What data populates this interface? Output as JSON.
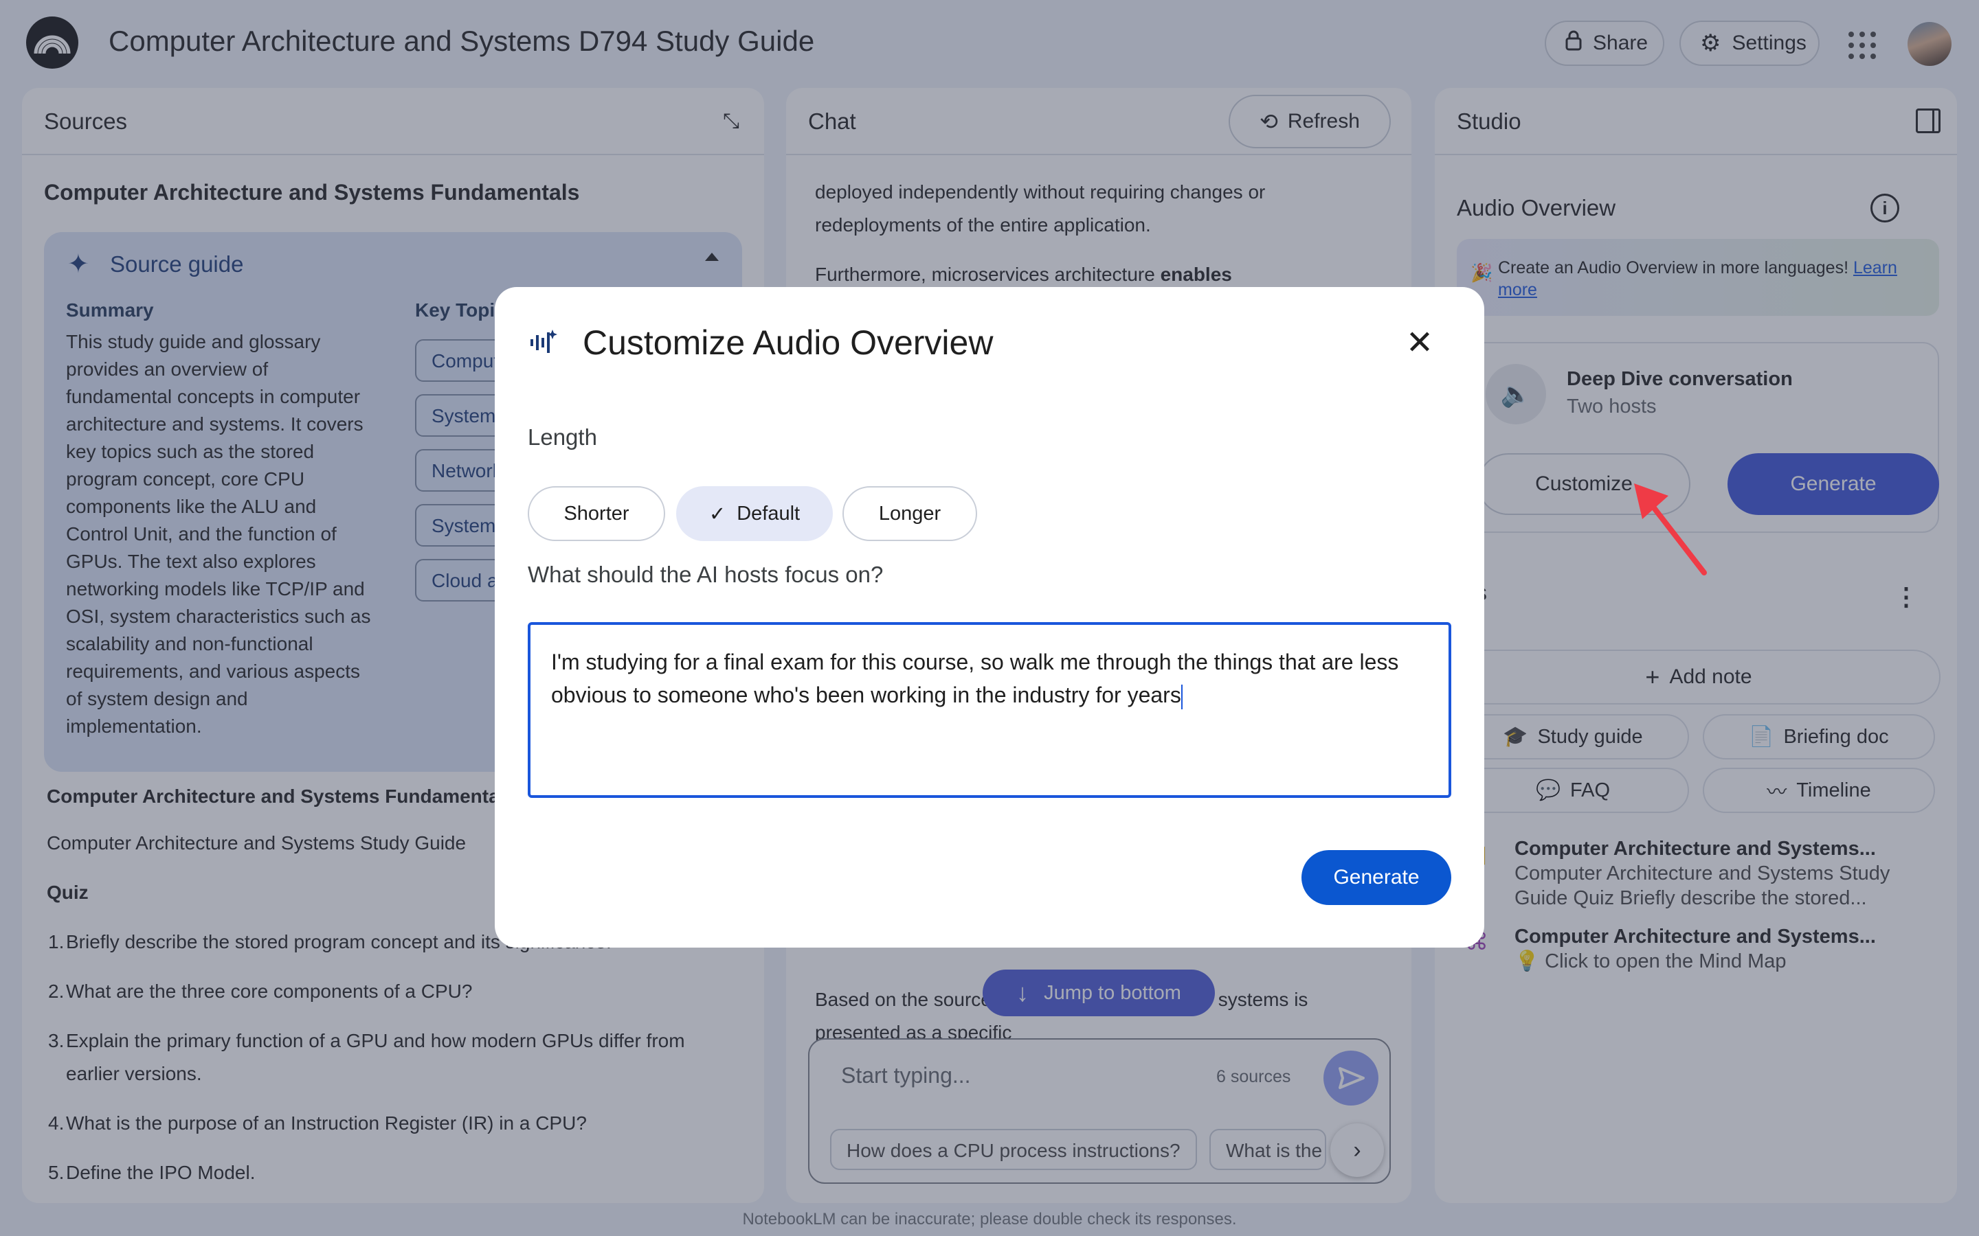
{
  "app": {
    "title": "Computer Architecture and Systems D794 Study Guide",
    "share_label": "Share",
    "settings_label": "Settings",
    "footer": "NotebookLM can be inaccurate; please double check its responses."
  },
  "sources": {
    "panel_title": "Sources",
    "heading": "Computer Architecture and Systems Fundamentals",
    "guide": {
      "title": "Source guide",
      "summary_label": "Summary",
      "topics_label": "Key Topics",
      "summary_text": "This study guide and glossary provides an overview of fundamental concepts in computer architecture and systems. It covers key topics such as the stored program concept, core CPU components like the ALU and Control Unit, and the function of GPUs. The text also explores networking models like TCP/IP and OSI, system characteristics such as scalability and non-functional requirements, and various aspects of system design and implementation.",
      "topics": [
        "Computer",
        "System c",
        "Networkin",
        "System d",
        "Cloud and"
      ]
    },
    "doc_title": "Computer Architecture and Systems Fundamental",
    "doc_subtitle": "Computer Architecture and Systems Study Guide",
    "quiz_label": "Quiz",
    "quiz": [
      {
        "num": "1.",
        "text": "Briefly describe the stored program concept and its significance."
      },
      {
        "num": "2.",
        "text": "What are the three core components of a CPU?"
      },
      {
        "num": "3.",
        "text": "Explain the primary function of a GPU and how modern GPUs differ from earlier versions."
      },
      {
        "num": "4.",
        "text": "What is the purpose of an Instruction Register (IR) in a CPU?"
      },
      {
        "num": "5.",
        "text": "Define the IPO Model."
      }
    ]
  },
  "chat": {
    "panel_title": "Chat",
    "refresh_label": "Refresh",
    "para1": "deployed independently without requiring changes or redeployments of the entire application.",
    "para2_start": "Furthermore, microservices architecture ",
    "para2_bold": "enables",
    "para3": "Based on the sources, the ... of network-aware systems is presented as a specific",
    "jump_label": "Jump to bottom",
    "composer_placeholder": "Start typing...",
    "sources_count": "6 sources",
    "suggestions": [
      "How does a CPU process instructions?",
      "What is the"
    ]
  },
  "studio": {
    "panel_title": "Studio",
    "audio_overview_label": "Audio Overview",
    "promo_text": "Create an Audio Overview in more languages!",
    "promo_link": "Learn more",
    "deep_dive_title": "Deep Dive conversation",
    "deep_dive_sub": "Two hosts",
    "customize_label": "Customize",
    "generate_label": "Generate",
    "notes_label": "tes",
    "add_note_label": "Add note",
    "note_buttons": [
      "Study guide",
      "Briefing doc",
      "FAQ",
      "Timeline"
    ],
    "notes": [
      {
        "title": "Computer Architecture and Systems...",
        "body": "Computer Architecture and Systems Study Guide Quiz Briefly describe the stored..."
      },
      {
        "title": "Computer Architecture and Systems...",
        "body": "💡 Click to open the Mind Map"
      }
    ]
  },
  "modal": {
    "title": "Customize Audio Overview",
    "length_label": "Length",
    "length_options": [
      "Shorter",
      "Default",
      "Longer"
    ],
    "selected_length": "Default",
    "focus_label": "What should the AI hosts focus on?",
    "focus_value": "I'm studying for a final exam for this course, so walk me through the things that are less obvious to someone who's been working in the industry for years",
    "generate_label": "Generate"
  },
  "colors": {
    "accent": "#0b57d0",
    "studio_generate": "#3a51d6",
    "annotation_arrow": "#ef3b46"
  }
}
